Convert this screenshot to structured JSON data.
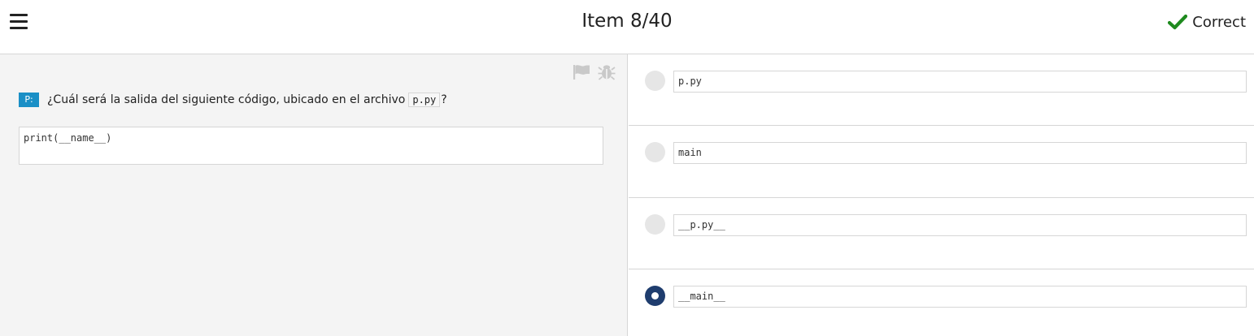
{
  "header": {
    "title": "Item 8/40",
    "status": "Correct",
    "status_color": "#1e8a1e"
  },
  "question": {
    "badge": "P:",
    "text_before": "¿Cuál será la salida del siguiente código, ubicado en el archivo",
    "inline_code": "p.py",
    "text_after": "?",
    "code": "print(__name__)"
  },
  "options": [
    {
      "label": "p.py",
      "selected": false
    },
    {
      "label": "main",
      "selected": false
    },
    {
      "label": "__p.py__",
      "selected": false
    },
    {
      "label": "__main__",
      "selected": true
    }
  ],
  "icons": {
    "menu": "hamburger-menu-icon",
    "status": "checkmark-icon",
    "flag": "flag-icon",
    "bug": "bug-icon"
  }
}
